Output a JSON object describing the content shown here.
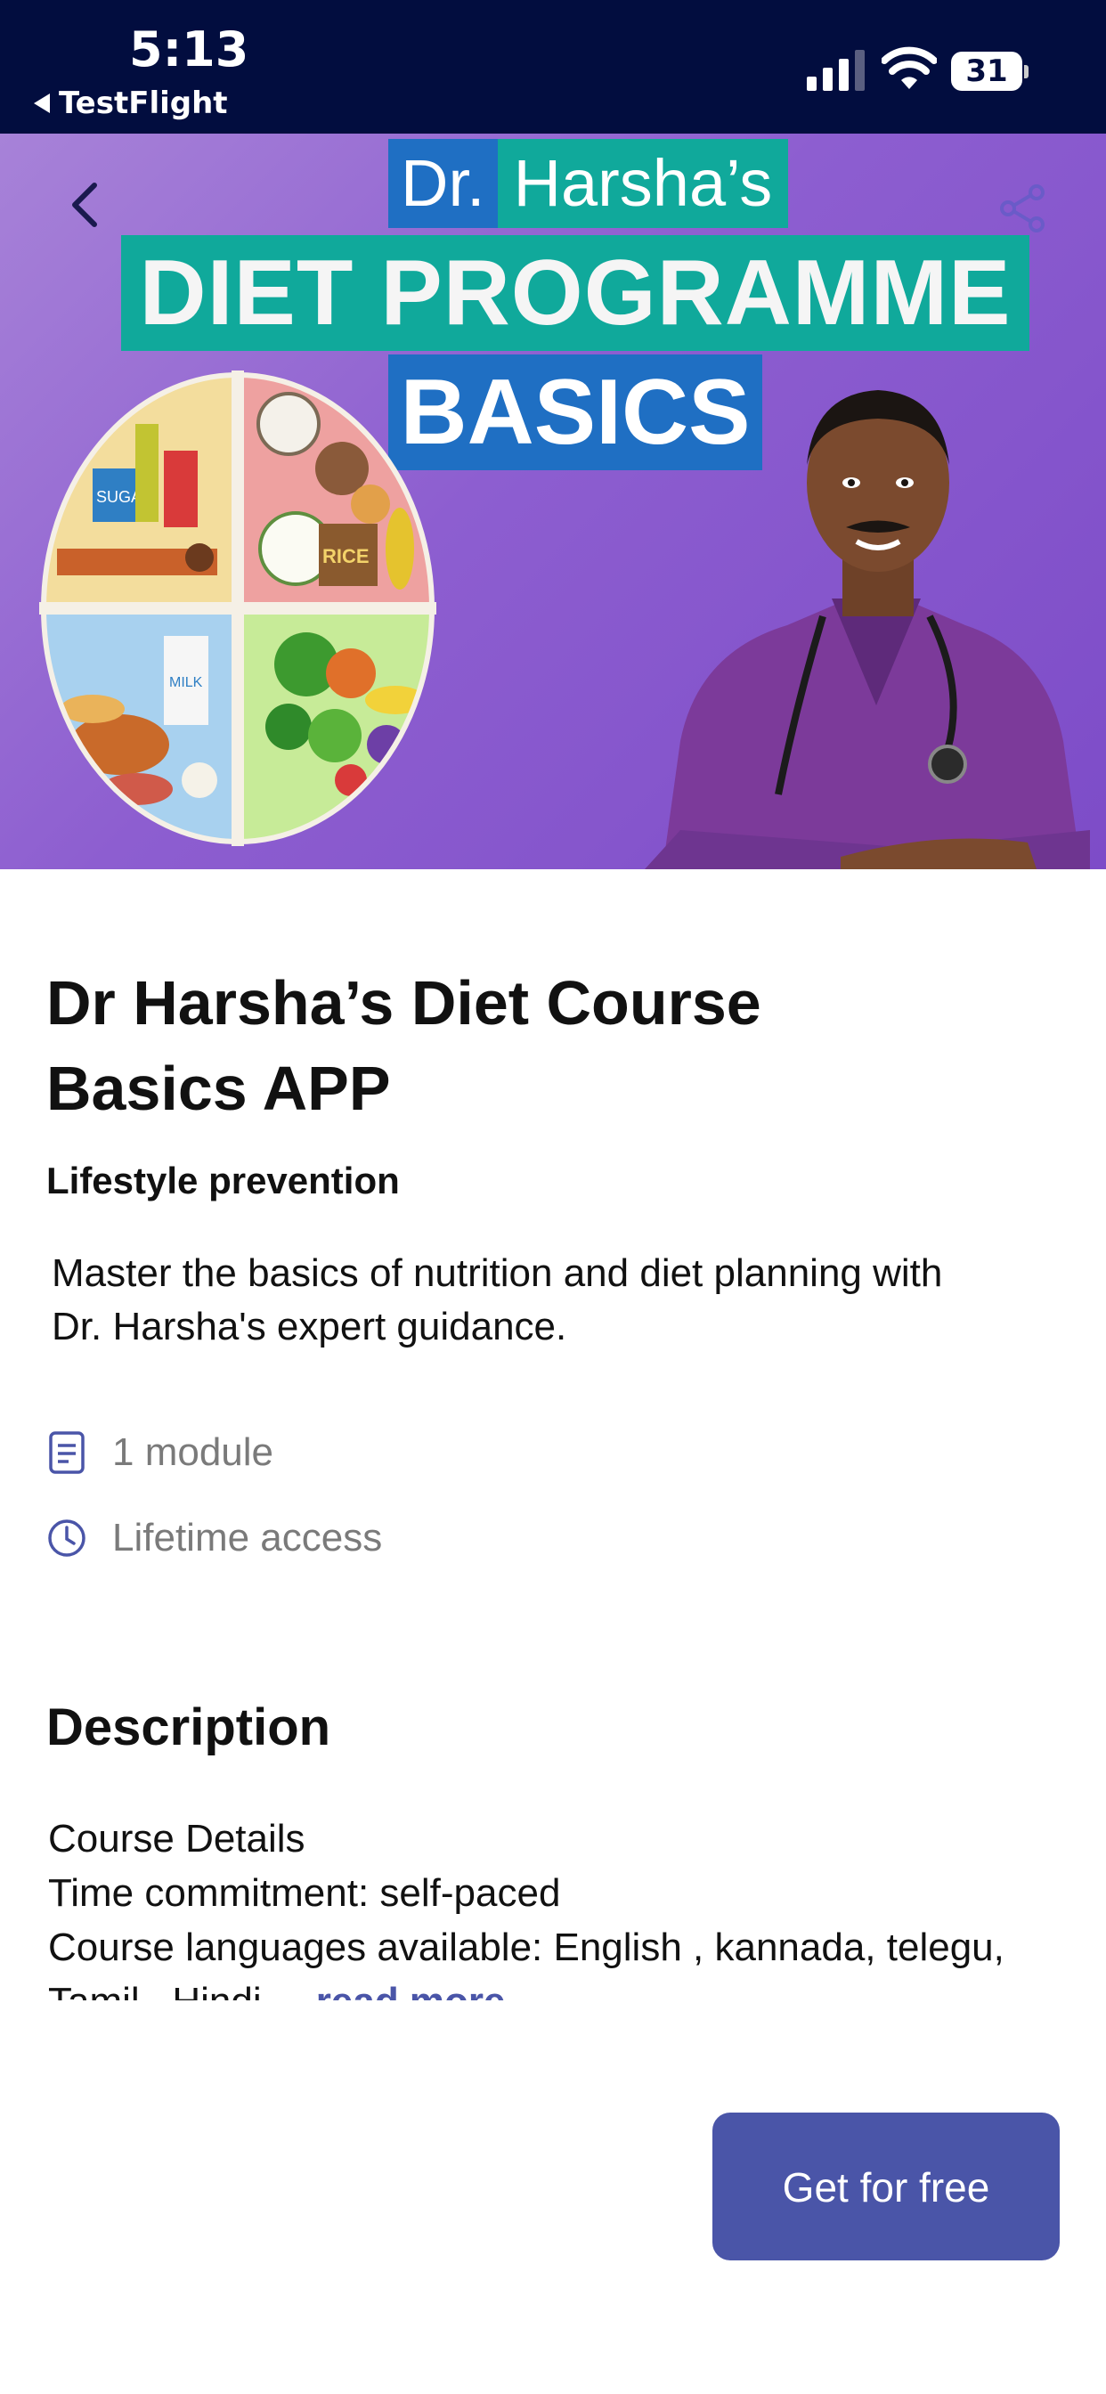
{
  "status_bar": {
    "time": "5:13",
    "back_app": "TestFlight",
    "battery": "31"
  },
  "hero": {
    "banner_dr": "Dr.",
    "banner_name": "Harsha’s",
    "banner_program": "DIET PROGRAMME",
    "banner_basics": "BASICS",
    "plate_labels": [
      "SUGA",
      "RICE",
      "MILK"
    ]
  },
  "course": {
    "title_line1": "Dr Harsha’s Diet Course",
    "title_line2": "Basics APP",
    "category": "Lifestyle prevention",
    "summary_line1": "Master the basics of nutrition and diet planning with",
    "summary_line2": "Dr. Harsha's expert guidance.",
    "modules": "1 module",
    "access": "Lifetime access"
  },
  "description": {
    "heading": "Description",
    "lines": [
      "Course Details",
      "Time commitment: self-paced",
      "Course languages available: English , kannada, telegu,",
      "Tamil , Hindi ..."
    ],
    "read_more": "read more"
  },
  "cta": {
    "label": "Get for free"
  },
  "colors": {
    "status_bg": "#020d3f",
    "accent": "#4a55a8",
    "banner_teal": "#10a99b",
    "banner_blue": "#1f6fc3"
  }
}
